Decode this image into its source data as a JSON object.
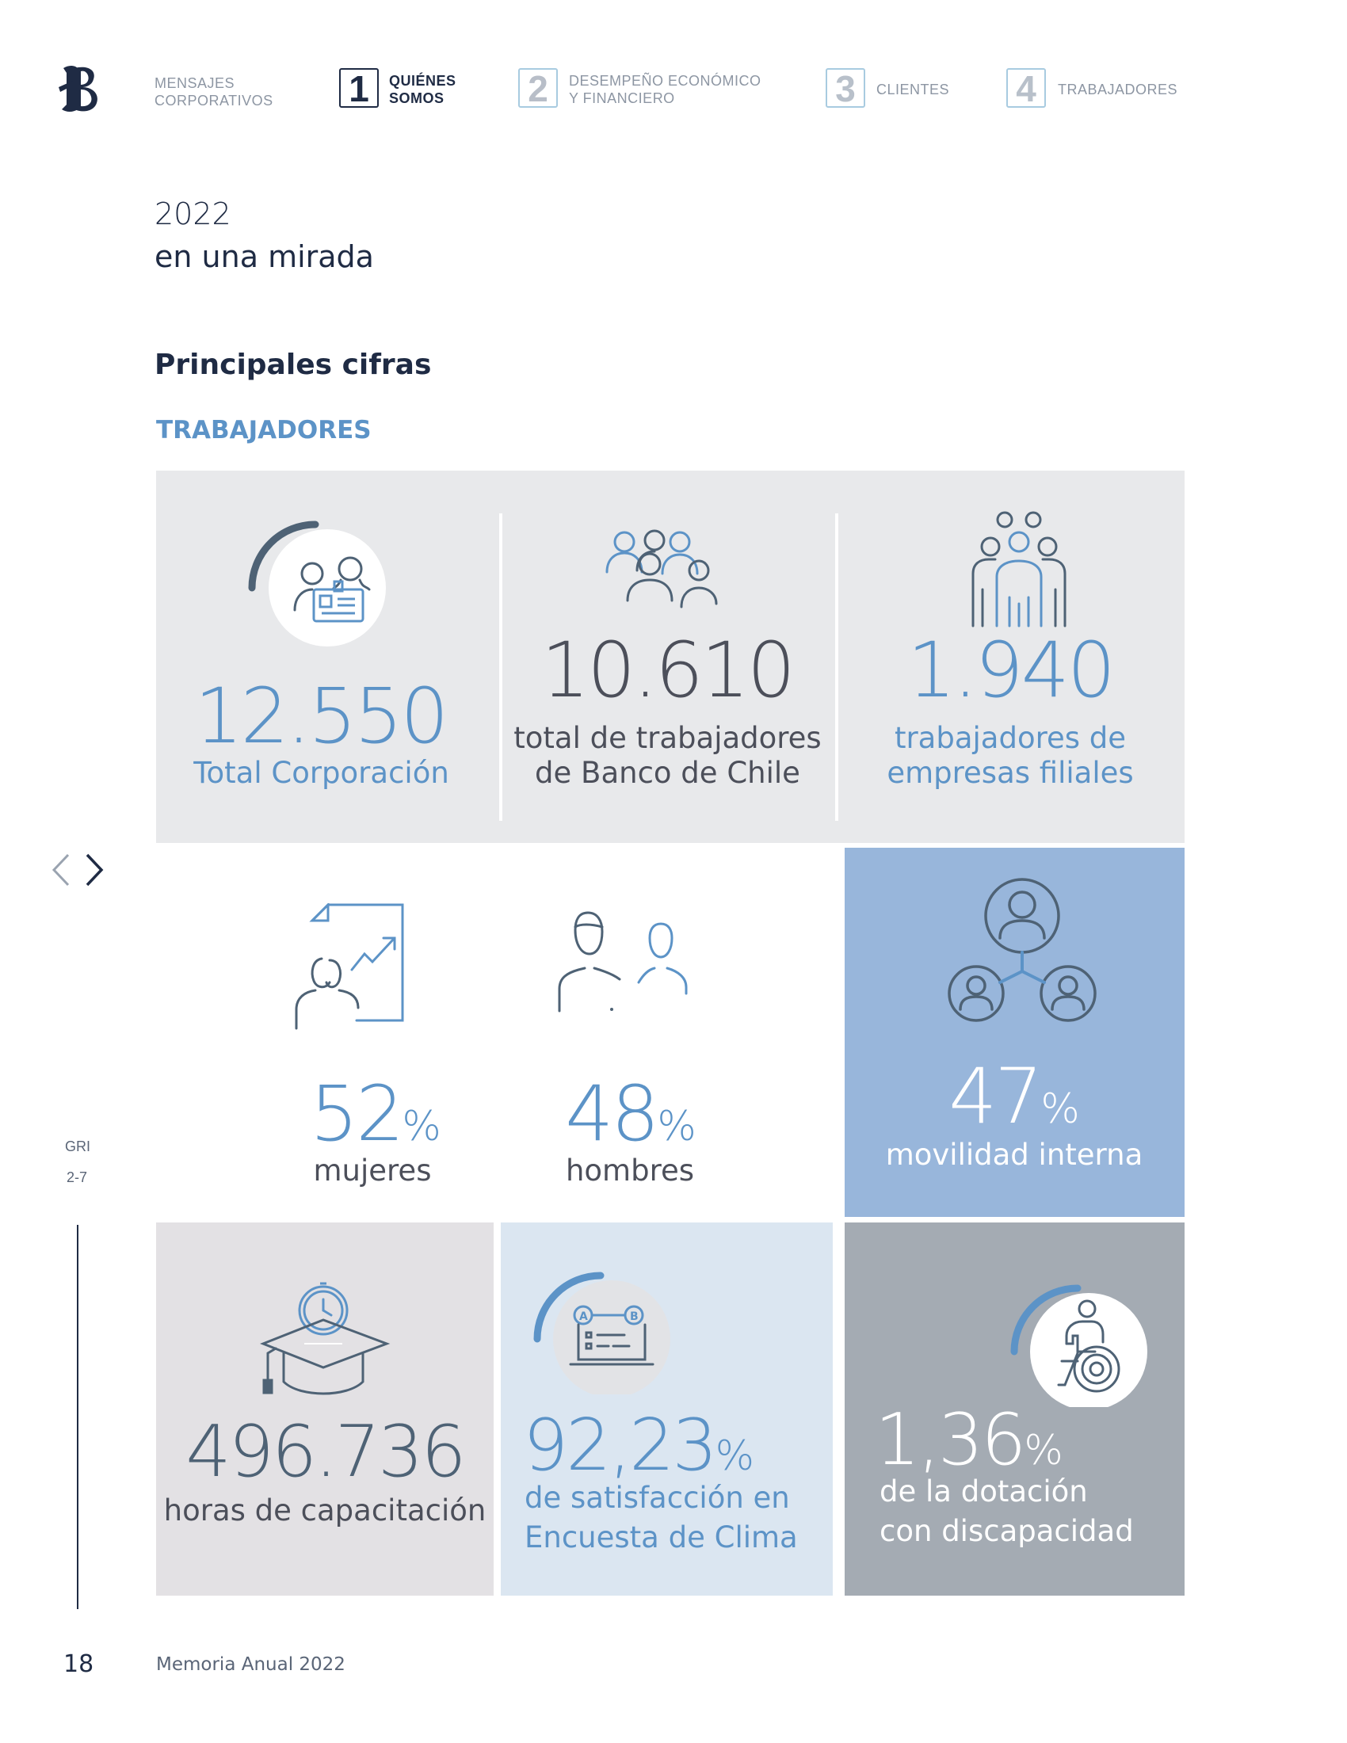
{
  "header": {
    "nav": [
      {
        "number": "",
        "label_line1": "MENSAJES",
        "label_line2": "CORPORATIVOS"
      },
      {
        "number": "1",
        "label_line1": "QUIÉNES",
        "label_line2": "SOMOS"
      },
      {
        "number": "2",
        "label_line1": "DESEMPEÑO ECONÓMICO",
        "label_line2": "Y FINANCIERO"
      },
      {
        "number": "3",
        "label_line1": "CLIENTES",
        "label_line2": ""
      },
      {
        "number": "4",
        "label_line1": "TRABAJADORES",
        "label_line2": ""
      }
    ]
  },
  "page": {
    "year": "2022",
    "subtitle": "en una mirada",
    "section_title": "Principales cifras",
    "category": "TRABAJADORES"
  },
  "stats": {
    "total_corp": {
      "value": "12.550",
      "label": "Total Corporación",
      "ring_fraction": 0.25
    },
    "banco": {
      "value": "10.610",
      "label_line1": "total de trabajadores",
      "label_line2": "de Banco de Chile"
    },
    "filiales": {
      "value": "1.940",
      "label_line1": "trabajadores de",
      "label_line2": "empresas filiales"
    },
    "mujeres": {
      "value": "52",
      "unit": "%",
      "label": "mujeres"
    },
    "hombres": {
      "value": "48",
      "unit": "%",
      "label": "hombres"
    },
    "movilidad": {
      "value": "47",
      "unit": "%",
      "label": "movilidad interna"
    },
    "horas": {
      "value": "496.736",
      "label": "horas de capacitación"
    },
    "satisfaccion": {
      "value": "92,23",
      "unit": "%",
      "label_line1": "de satisfacción en",
      "label_line2": "Encuesta de Clima",
      "ring_fraction": 0.25
    },
    "discapacidad": {
      "value": "1,36",
      "unit": "%",
      "label_line1": "de la dotación",
      "label_line2": "con discapacidad",
      "ring_fraction": 0.25
    }
  },
  "sidebar": {
    "gri_line1": "GRI",
    "gri_line2": "2-7"
  },
  "footer": {
    "page_number": "18",
    "title": "Memoria Anual 2022"
  },
  "colors": {
    "navy": "#1f2b44",
    "blue": "#5c93c7",
    "slate": "#4e6275",
    "gray_panel": "#e8e9eb",
    "mauve_panel": "#e3e1e4",
    "light_blue_panel": "#dbe6f1",
    "mid_blue_panel": "#98b6db",
    "steel_panel": "#a4abb3"
  },
  "icons": [
    "bank-logo-icon",
    "id-card-people-icon",
    "group-people-icon",
    "family-group-icon",
    "woman-growth-chart-icon",
    "man-people-icon",
    "network-people-icon",
    "graduation-clock-icon",
    "survey-ab-icon",
    "wheelchair-icon",
    "chevron-left-icon",
    "chevron-right-icon"
  ]
}
